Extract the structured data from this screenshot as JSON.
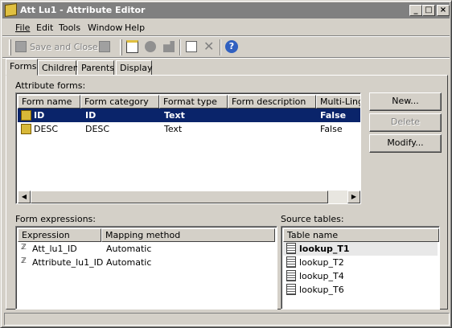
{
  "window": {
    "title": "Att Lu1 - Attribute Editor"
  },
  "menu": [
    "File",
    "Edit",
    "Tools",
    "Window",
    "Help"
  ],
  "toolbar": {
    "save_close": "Save and Close"
  },
  "tabs": [
    "Forms",
    "Children",
    "Parents",
    "Display"
  ],
  "attribute_forms": {
    "label": "Attribute forms:",
    "columns": [
      "Form name",
      "Form category",
      "Format type",
      "Form description",
      "Multi-Lingu"
    ],
    "rows": [
      {
        "name": "ID",
        "category": "ID",
        "format": "Text",
        "description": "",
        "multi": "False",
        "selected": true
      },
      {
        "name": "DESC",
        "category": "DESC",
        "format": "Text",
        "description": "",
        "multi": "False",
        "selected": false
      }
    ]
  },
  "buttons": {
    "new": "New...",
    "delete": "Delete",
    "modify": "Modify..."
  },
  "form_expressions": {
    "label": "Form expressions:",
    "columns": [
      "Expression",
      "Mapping method"
    ],
    "rows": [
      {
        "expression": "Att_lu1_ID",
        "mapping": "Automatic"
      },
      {
        "expression": "Attribute_lu1_ID",
        "mapping": "Automatic"
      }
    ]
  },
  "source_tables": {
    "label": "Source tables:",
    "column": "Table name",
    "rows": [
      "lookup_T1",
      "lookup_T2",
      "lookup_T4",
      "lookup_T6"
    ]
  }
}
